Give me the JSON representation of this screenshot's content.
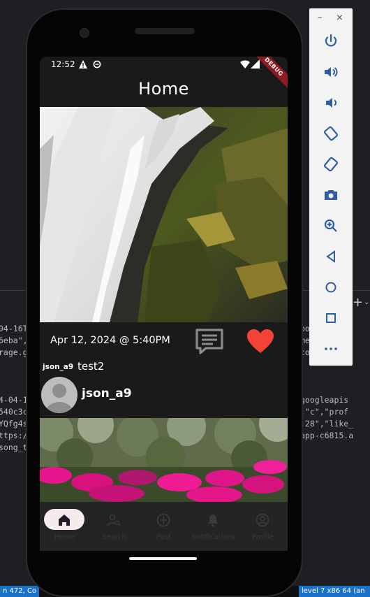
{
  "ide": {
    "left_lines": [
      "04-16T",
      "6eba\",",
      "rage.g",
      "",
      "",
      "",
      "4-04-1",
      "540c3c",
      "YQfg4s",
      "ttps:/",
      "song_t"
    ],
    "right_lines": [
      "oo",
      "me",
      "co",
      "",
      "",
      "",
      "googleapis",
      ":\"c\",\"prof",
      ":28\",\"like_",
      "app-c6815.a"
    ],
    "status_left": "n 472, Co",
    "status_right": "level 7 x86 64 (an",
    "plus": "+",
    "chevron": "⌄"
  },
  "emulator_toolbar": {
    "minimize": "–",
    "close": "×",
    "buttons": [
      "power",
      "volume-up",
      "volume-down",
      "rotate-left",
      "rotate-right",
      "screenshot",
      "zoom",
      "back",
      "home",
      "overview",
      "more"
    ]
  },
  "status_bar": {
    "time": "12:52",
    "debug_banner": "DEBUG"
  },
  "app": {
    "title": "Home",
    "post": {
      "date": "Apr 12, 2024 @ 5:40PM",
      "caption_user": "json_a9",
      "caption_text": "test2",
      "liked": true,
      "heart_color": "#f44336"
    },
    "next_post": {
      "author": "json_a9"
    }
  },
  "nav": [
    {
      "label": "Home",
      "icon": "home-icon",
      "active": true
    },
    {
      "label": "Search",
      "icon": "search-user-icon",
      "active": false
    },
    {
      "label": "Post",
      "icon": "add-circle-icon",
      "active": false
    },
    {
      "label": "Notifications",
      "icon": "bell-icon",
      "active": false
    },
    {
      "label": "Profile",
      "icon": "profile-icon",
      "active": false
    }
  ],
  "colors": {
    "screen_bg": "#1a1a1a",
    "nav_bg": "#242426",
    "pill": "#f4ecec",
    "accent_heart": "#f44336"
  }
}
